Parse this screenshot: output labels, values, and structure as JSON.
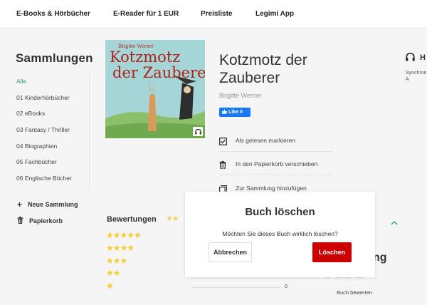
{
  "nav": {
    "items": [
      "E-Books & Hörbücher",
      "E-Reader für 1 EUR",
      "Preisliste",
      "Legimi App"
    ]
  },
  "sidebar": {
    "title": "Sammlungen",
    "items": [
      "Alle",
      "01 Kinderhörbücher",
      "02 eBooks",
      "03 Fantasy / Thriller",
      "04 Biographien",
      "05 Fachbücher",
      "06 Englische Bücher"
    ],
    "new_collection": "Neue Sammlung",
    "trash": "Papierkorb"
  },
  "book": {
    "cover": {
      "author": "Brigitte Werner",
      "title_line1": "Kotzmotz",
      "title_line2": "der Zauberer"
    },
    "title": "Kotzmotz der Zauberer",
    "author": "Brigitte Werner",
    "like_label": "Like 0",
    "actions": [
      "Als gelesen markieren",
      "In den Papierkorb verschieben",
      "Zur Sammlung hinzufügen"
    ]
  },
  "ratings": {
    "title": "Bewertungen",
    "rows": [
      "★★★★★",
      "★★★★",
      "★★★",
      "★★",
      "★"
    ],
    "head_stars": "★★",
    "count": "0"
  },
  "right_panel": {
    "heading": "H",
    "text": "Synchron aktivem A"
  },
  "background": {
    "heading_fragment": "ng",
    "stars": "★★★★",
    "last_star": "★",
    "rate_label": "Buch bewerten"
  },
  "modal": {
    "title": "Buch löschen",
    "text": "Möchten Sie dieses Buch wirklich löschen?",
    "cancel": "Abbrechen",
    "delete": "Löschen"
  },
  "colors": {
    "accent_green": "#2a9d6f",
    "delete_red": "#cc0000",
    "star_yellow": "#f4cc33",
    "facebook_blue": "#1877f2"
  }
}
